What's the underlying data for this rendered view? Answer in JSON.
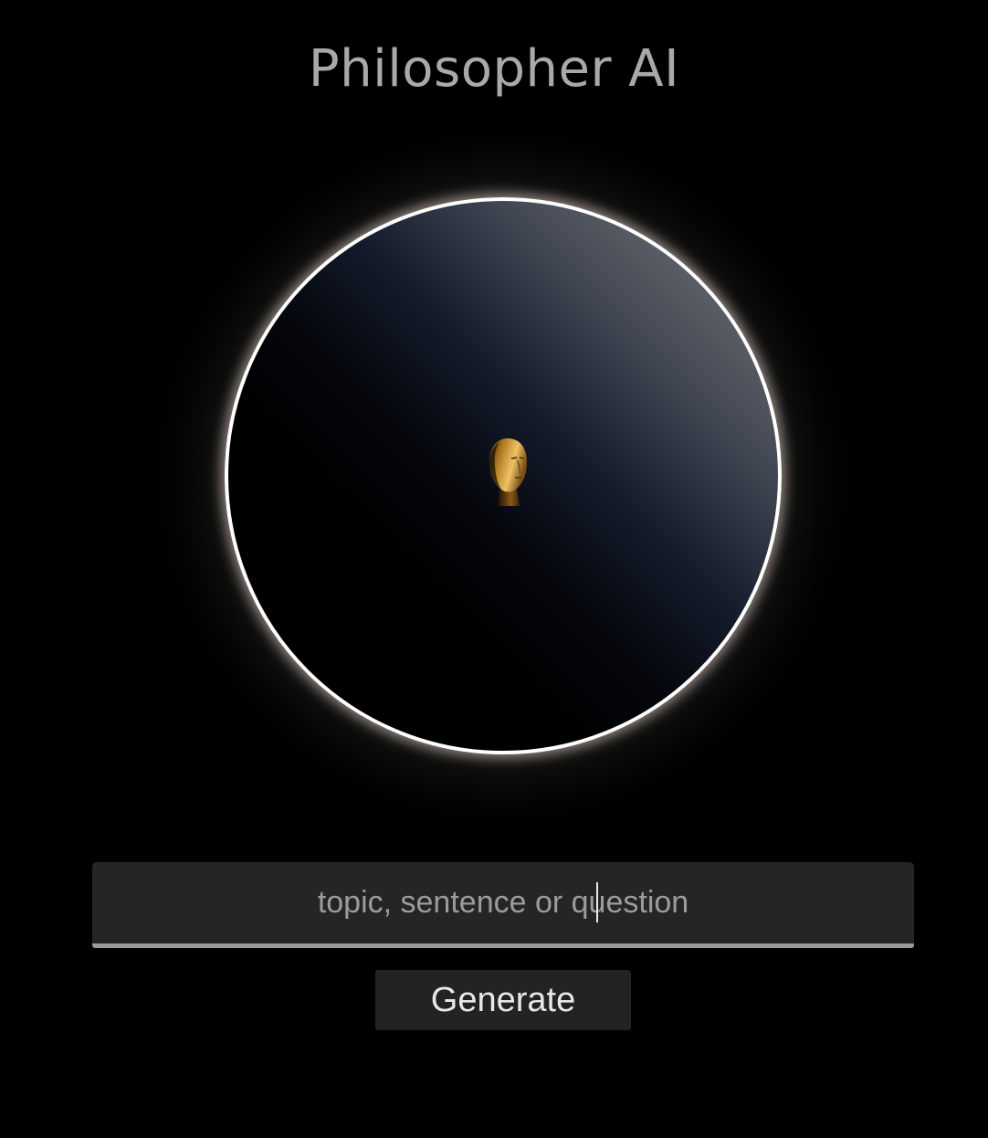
{
  "header": {
    "title": "Philosopher AI"
  },
  "orb": {
    "icon": "philosopher-head-icon",
    "accent_colors": {
      "ring": "#ffffff",
      "glow": "#f5e6dc",
      "gradient_light": "#7a7a7a",
      "gradient_dark": "#000000",
      "head_face": "#e0a640"
    }
  },
  "prompt": {
    "value": "",
    "placeholder": "topic, sentence or question"
  },
  "actions": {
    "generate_label": "Generate"
  }
}
